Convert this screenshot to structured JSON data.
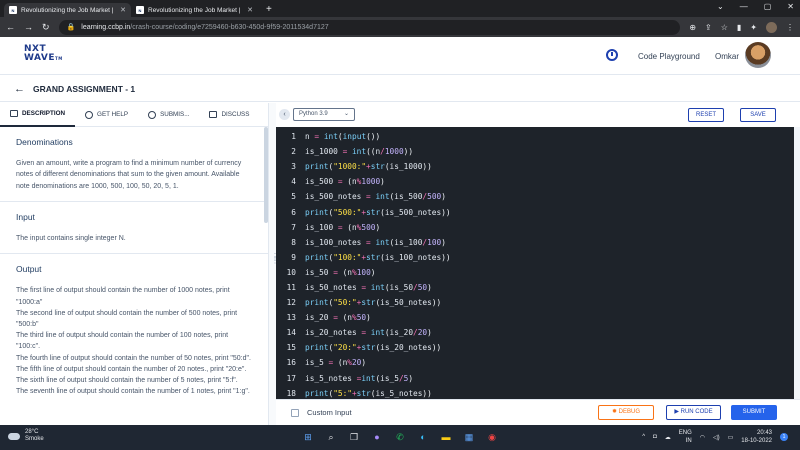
{
  "browser": {
    "tabs": [
      {
        "title": "Revolutionizing the Job Market |",
        "active": true
      },
      {
        "title": "Revolutionizing the Job Market |",
        "active": false
      }
    ],
    "url_domain": "learning.ccbp.in",
    "url_path": "/crash-course/coding/e7259460-b630-450d-9f59-2011534d7127"
  },
  "header": {
    "logo_line1": "NXT",
    "logo_line2": "WAVE",
    "logo_tm": "TM",
    "code_playground": "Code Playground",
    "user_name": "Omkar"
  },
  "assignment": {
    "title": "GRAND ASSIGNMENT - 1"
  },
  "left_tabs": [
    "DESCRIPTION",
    "GET HELP",
    "SUBMIS...",
    "DISCUSS"
  ],
  "description": {
    "title": "Denominations",
    "intro": "Given an amount, write a program to find a minimum number of currency notes of different denominations that sum to the given amount. Available note denominations are 1000, 500, 100, 50, 20, 5, 1.",
    "input_heading": "Input",
    "input_text": "The input contains single integer N.",
    "output_heading": "Output",
    "output_lines": [
      "The first line of output should contain the number of 1000 notes, print \"1000:a\"",
      "The second line of output should contain the number of 500 notes, print \"500:b\"",
      "The third line of output should contain the number of 100 notes, print \"100:c\".",
      "The fourth line of output should contain the number of 50 notes, print \"50:d\".",
      "The fifth line of output should contain the number of 20 notes., print \"20:e\".",
      "The sixth line of output should contain the number of 5 notes, print \"5:f\".",
      "The seventh line of output should contain the number of 1 notes, print \"1:g\"."
    ]
  },
  "editor": {
    "language": "Python 3.9",
    "reset_label": "RESET",
    "save_label": "SAVE",
    "lines": [
      "n = int(input())",
      "is_1000 = int((n/1000))",
      "print(\"1000:\"+str(is_1000))",
      "is_500 = (n%1000)",
      "is_500_notes = int(is_500/500)",
      "print(\"500:\"+str(is_500_notes))",
      "is_100 = (n%500)",
      "is_100_notes = int(is_100/100)",
      "print(\"100:\"+str(is_100_notes))",
      "is_50 = (n%100)",
      "is_50_notes = int(is_50/50)",
      "print(\"50:\"+str(is_50_notes))",
      "is_20 = (n%50)",
      "is_20_notes = int(is_20/20)",
      "print(\"20:\"+str(is_20_notes))",
      "is_5 = (n%20)",
      "is_5_notes =int(is_5/5)",
      "print(\"5:\"+str(is_5_notes))"
    ]
  },
  "bottom": {
    "custom_input_label": "Custom Input",
    "debug_label": "DEBUG",
    "run_label": "RUN CODE",
    "submit_label": "SUBMIT"
  },
  "taskbar": {
    "temperature": "28°C",
    "weather": "Smoke",
    "lang1": "ENG",
    "lang2": "IN",
    "time": "20:43",
    "date": "18-10-2022",
    "notifications": "1"
  },
  "colors": {
    "editor_bg": "#1e232a",
    "keyword": "#e2e8f0",
    "builtin": "#7dd3fc",
    "string": "#fde047",
    "number": "#c4b5fd",
    "operator": "#f472b6",
    "primary": "#1e40af",
    "debug": "#f97316"
  }
}
